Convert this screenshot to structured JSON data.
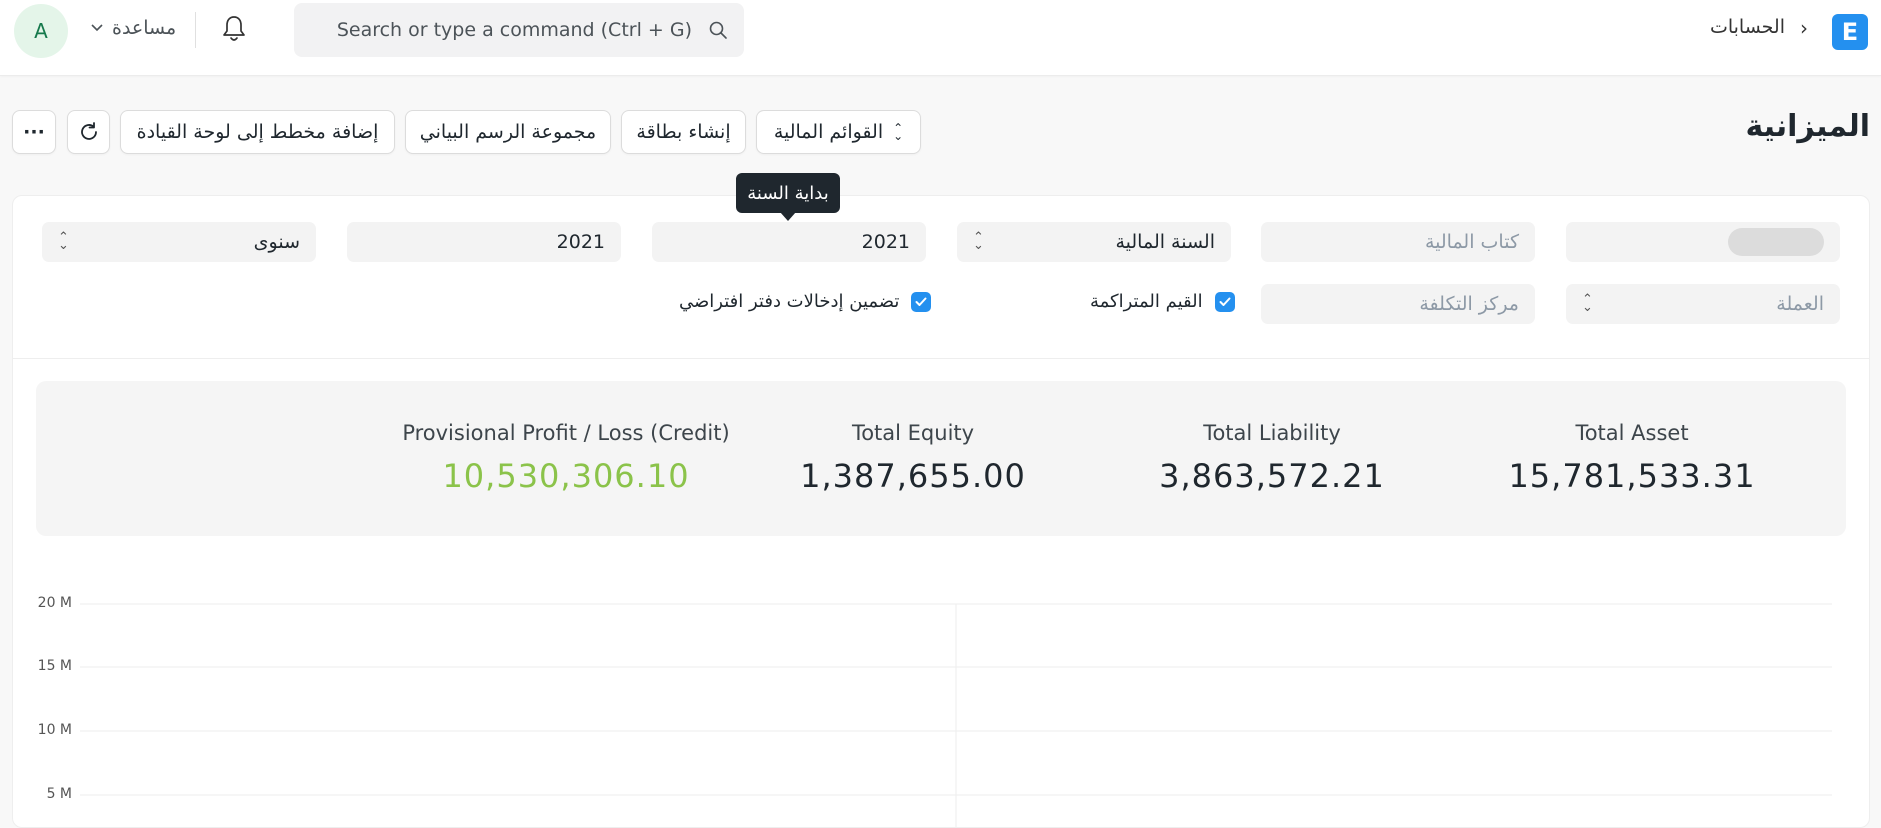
{
  "navbar": {
    "logo_letter": "E",
    "breadcrumb_sep": "›",
    "breadcrumb": "الحسابات",
    "search_placeholder": "Search or type a command (Ctrl + G)",
    "help_label": "مساعدة",
    "avatar_letter": "A"
  },
  "page": {
    "title": "الميزانية",
    "buttons": {
      "financial_statements": "القوائم المالية",
      "create_card": "إنشاء بطاقة",
      "chart_group": "مجموعة الرسم البياني",
      "add_to_dashboard": "إضافة مخطط إلى لوحة القيادة",
      "more": "···"
    },
    "tooltip": "بداية السنة"
  },
  "filters": {
    "company_value": "",
    "finance_book_placeholder": "كتاب المالية",
    "filter_based_on": "السنة المالية",
    "from_year": "2021",
    "to_year": "2021",
    "periodicity": "سنوى",
    "currency_placeholder": "العملة",
    "cost_center_placeholder": "مركز التكلفة",
    "accumulated_values_label": "القيم المتراكمة",
    "include_default_book_label": "تضمين إدخالات دفتر افتراضي"
  },
  "summary": [
    {
      "label": "Total Asset",
      "value": "15,781,533.31",
      "color": "#1f272e"
    },
    {
      "label": "Total Liability",
      "value": "3,863,572.21",
      "color": "#1f272e"
    },
    {
      "label": "Total Equity",
      "value": "1,387,655.00",
      "color": "#1f272e"
    },
    {
      "label": "Provisional Profit / Loss (Credit)",
      "value": "10,530,306.10",
      "color": "#8bc34a"
    }
  ],
  "chart_data": {
    "type": "bar",
    "y_ticks": [
      "20 M",
      "15 M",
      "10 M",
      "5 M"
    ],
    "ylim_visible": [
      5000000,
      20000000
    ]
  }
}
